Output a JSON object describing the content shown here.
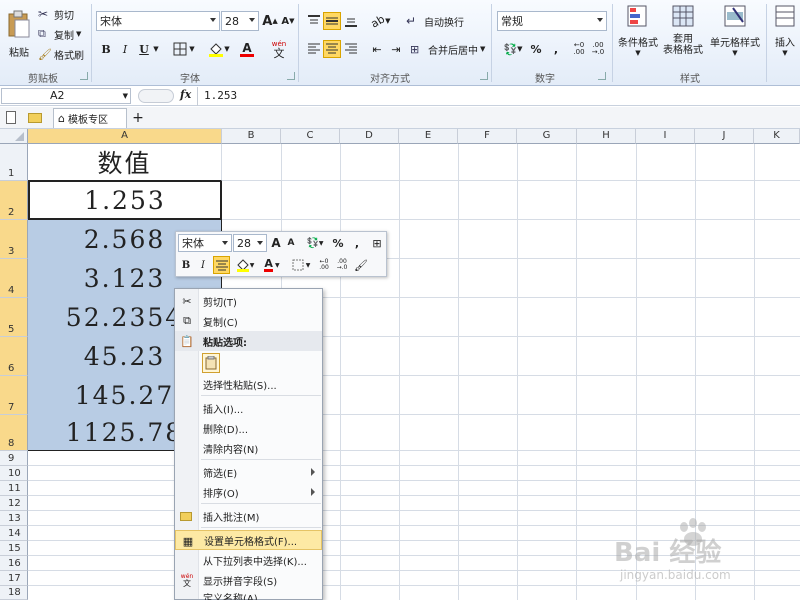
{
  "ribbon": {
    "clipboard": {
      "paste": "粘贴",
      "cut": "剪切",
      "copy": "复制",
      "format_painter": "格式刷",
      "label": "剪贴板"
    },
    "font": {
      "name": "宋体",
      "size": "28",
      "bold": "B",
      "italic": "I",
      "underline": "U",
      "grow": "A",
      "shrink": "A",
      "label": "字体",
      "phonetic": "wén"
    },
    "alignment": {
      "wrap": "自动换行",
      "merge": "合并后居中",
      "label": "对齐方式"
    },
    "number": {
      "format": "常规",
      "percent": "%",
      "comma": ",",
      "label": "数字"
    },
    "styles": {
      "conditional": "条件格式",
      "table1": "套用",
      "table2": "表格格式",
      "cell_styles": "单元格样式",
      "label": "样式"
    },
    "cells": {
      "insert": "插入"
    }
  },
  "formula_bar": {
    "name_box": "A2",
    "fx": "fx",
    "value": "1.253"
  },
  "tabs": {
    "template": "模板专区",
    "add": "+"
  },
  "grid": {
    "columns": [
      "A",
      "B",
      "C",
      "D",
      "E",
      "F",
      "G",
      "H",
      "I",
      "J",
      "K"
    ],
    "rows": [
      "1",
      "2",
      "3",
      "4",
      "5",
      "6",
      "7",
      "8",
      "9",
      "10",
      "11",
      "12",
      "13",
      "14",
      "15",
      "16",
      "17",
      "18"
    ],
    "cells_a": [
      "数值",
      "1.253",
      "2.568",
      "3.123",
      "52.2354",
      "45.23",
      "145.27",
      "1125.78"
    ]
  },
  "mini_toolbar": {
    "font": "宋体",
    "size": "28",
    "percent": "%",
    "comma": ",",
    "bold": "B",
    "italic": "I",
    "font_color": "A",
    "grow": "A",
    "shrink": "A"
  },
  "context_menu": {
    "cut": "剪切(T)",
    "copy": "复制(C)",
    "paste_options": "粘贴选项:",
    "paste_special": "选择性粘贴(S)...",
    "insert": "插入(I)...",
    "delete": "删除(D)...",
    "clear": "清除内容(N)",
    "filter": "筛选(E)",
    "sort": "排序(O)",
    "insert_comment": "插入批注(M)",
    "format_cells": "设置单元格格式(F)...",
    "pick_list": "从下拉列表中选择(K)...",
    "phonetic": "显示拼音字段(S)",
    "define_name": "定义名称(A)..."
  },
  "watermark": {
    "brand": "Bai 经验",
    "url": "jingyan.baidu.com"
  },
  "colors": {
    "selection": "#b8cce4",
    "header_selected": "#f9d98b",
    "highlight": "#ffd863"
  }
}
